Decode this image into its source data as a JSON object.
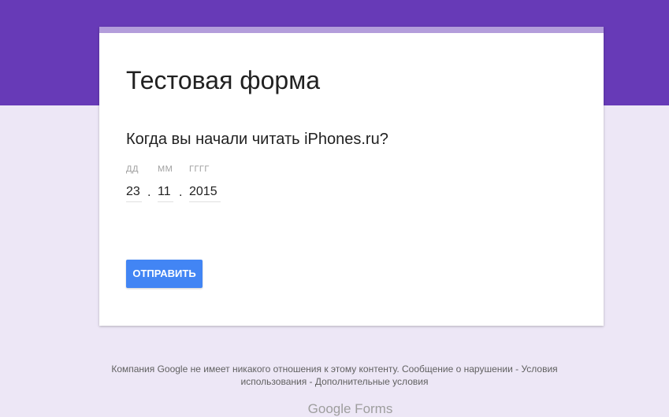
{
  "form": {
    "title": "Тестовая форма",
    "question": "Когда вы начали читать iPhones.ru?",
    "date_labels": {
      "day": "ДД",
      "month": "ММ",
      "year": "ГГГГ"
    },
    "date_values": {
      "day": "23",
      "month": "11",
      "year": "2015"
    },
    "separator": ".",
    "submit_label": "ОТПРАВИТЬ"
  },
  "footer": {
    "line1": "Компания Google не имеет никакого отношения к этому контенту. Сообщение о нарушении - Условия",
    "line2": "использования - Дополнительные условия",
    "brand": "Google Forms"
  },
  "colors": {
    "header_band": "#673ab7",
    "page_background": "#ede7f6",
    "card_accent": "#b39ddb",
    "submit_button": "#4285f4"
  }
}
